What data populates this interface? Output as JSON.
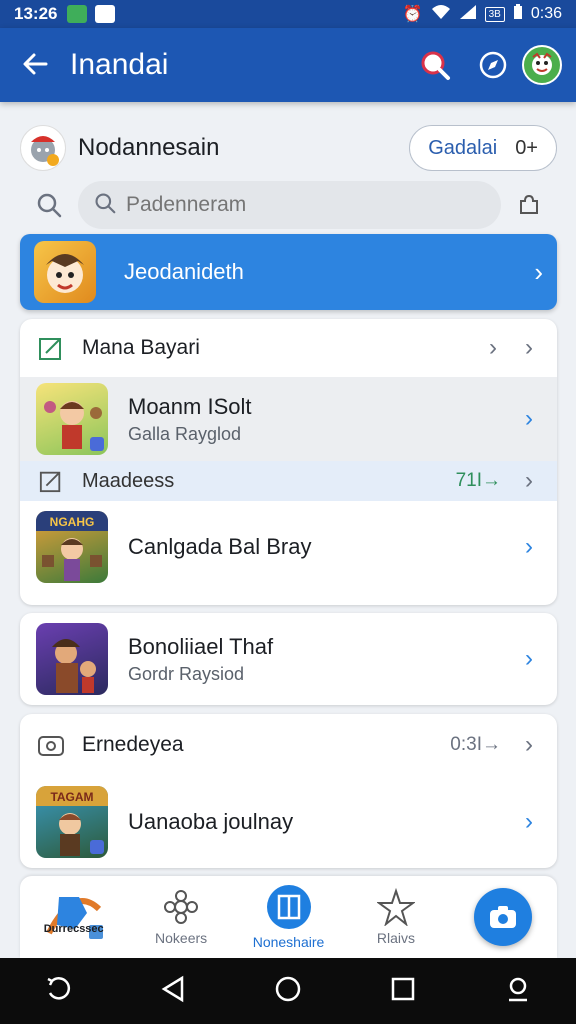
{
  "status": {
    "time": "13:26",
    "right_box": "3B",
    "battery": "0:36"
  },
  "appbar": {
    "title": "Inandai",
    "back_icon": "arrow-left-icon",
    "search_icon": "search-icon",
    "compass_icon": "compass-icon"
  },
  "profile": {
    "name": "Nodannesain",
    "pill_label": "Gadalai",
    "pill_value": "0+"
  },
  "search": {
    "placeholder": "Padenneram"
  },
  "featured": {
    "label": "Jeodanideth"
  },
  "section1": {
    "header": "Mana Bayari",
    "game1": {
      "title": "Moanm ISolt",
      "subtitle": "Galla Rayglod"
    },
    "subheader": "Maadeess",
    "subheader_meta": "71I→"
  },
  "game2": {
    "title": "Canlgada Bal Bray",
    "thumb_text": "NGAHG"
  },
  "game3": {
    "title": "Bonoliiael Thaf",
    "subtitle": "Gordr Raysiod"
  },
  "section2": {
    "header": "Ernedeyea",
    "header_meta": "0:3I→",
    "game4": {
      "title": "Uanaoba joulnay",
      "thumb_text": "TAGAM"
    }
  },
  "bottomnav": {
    "logo_text": "Durrecssec",
    "item1": "Nokeers",
    "item2": "Noneshaire",
    "item3": "Rlaivs"
  },
  "colors": {
    "primary": "#1d57b3",
    "accent": "#2d84e0",
    "green": "#2f8f5c"
  }
}
